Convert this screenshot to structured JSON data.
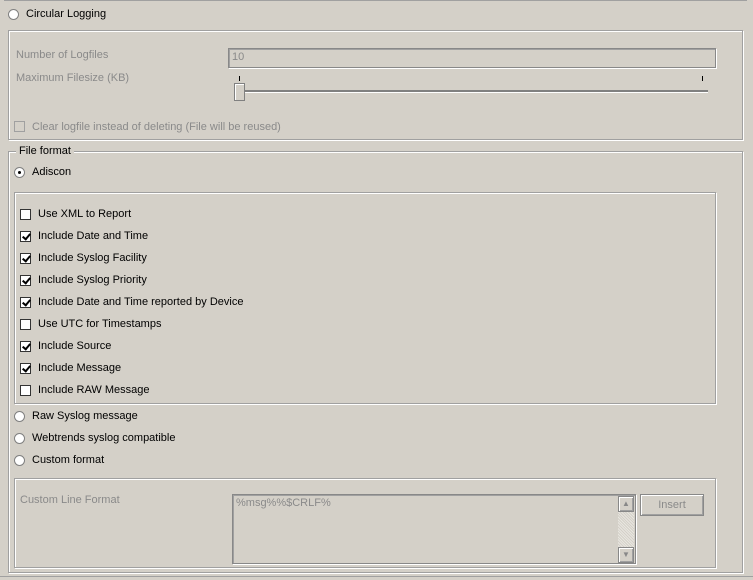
{
  "circular": {
    "radio_label": "Circular Logging",
    "num_logfiles_label": "Number of Logfiles",
    "num_logfiles_value": "10",
    "max_filesize_label": "Maximum Filesize (KB)",
    "slider_level": 0,
    "clear_label": "Clear logfile instead of deleting (File will be reused)"
  },
  "file_format": {
    "legend": "File format",
    "adiscon_label": "Adiscon",
    "options": [
      {
        "label": "Use XML to Report",
        "checked": false
      },
      {
        "label": "Include Date and Time",
        "checked": true
      },
      {
        "label": "Include Syslog Facility",
        "checked": true
      },
      {
        "label": "Include Syslog Priority",
        "checked": true
      },
      {
        "label": "Include Date and Time reported by Device",
        "checked": true
      },
      {
        "label": "Use UTC for Timestamps",
        "checked": false
      },
      {
        "label": "Include Source",
        "checked": true
      },
      {
        "label": "Include Message",
        "checked": true
      },
      {
        "label": "Include RAW Message",
        "checked": false
      }
    ],
    "raw_label": "Raw Syslog message",
    "webtrends_label": "Webtrends syslog compatible",
    "custom_label": "Custom format",
    "custom_line_label": "Custom Line Format",
    "custom_line_value": "%msg%%$CRLF%",
    "insert_label": "Insert"
  }
}
